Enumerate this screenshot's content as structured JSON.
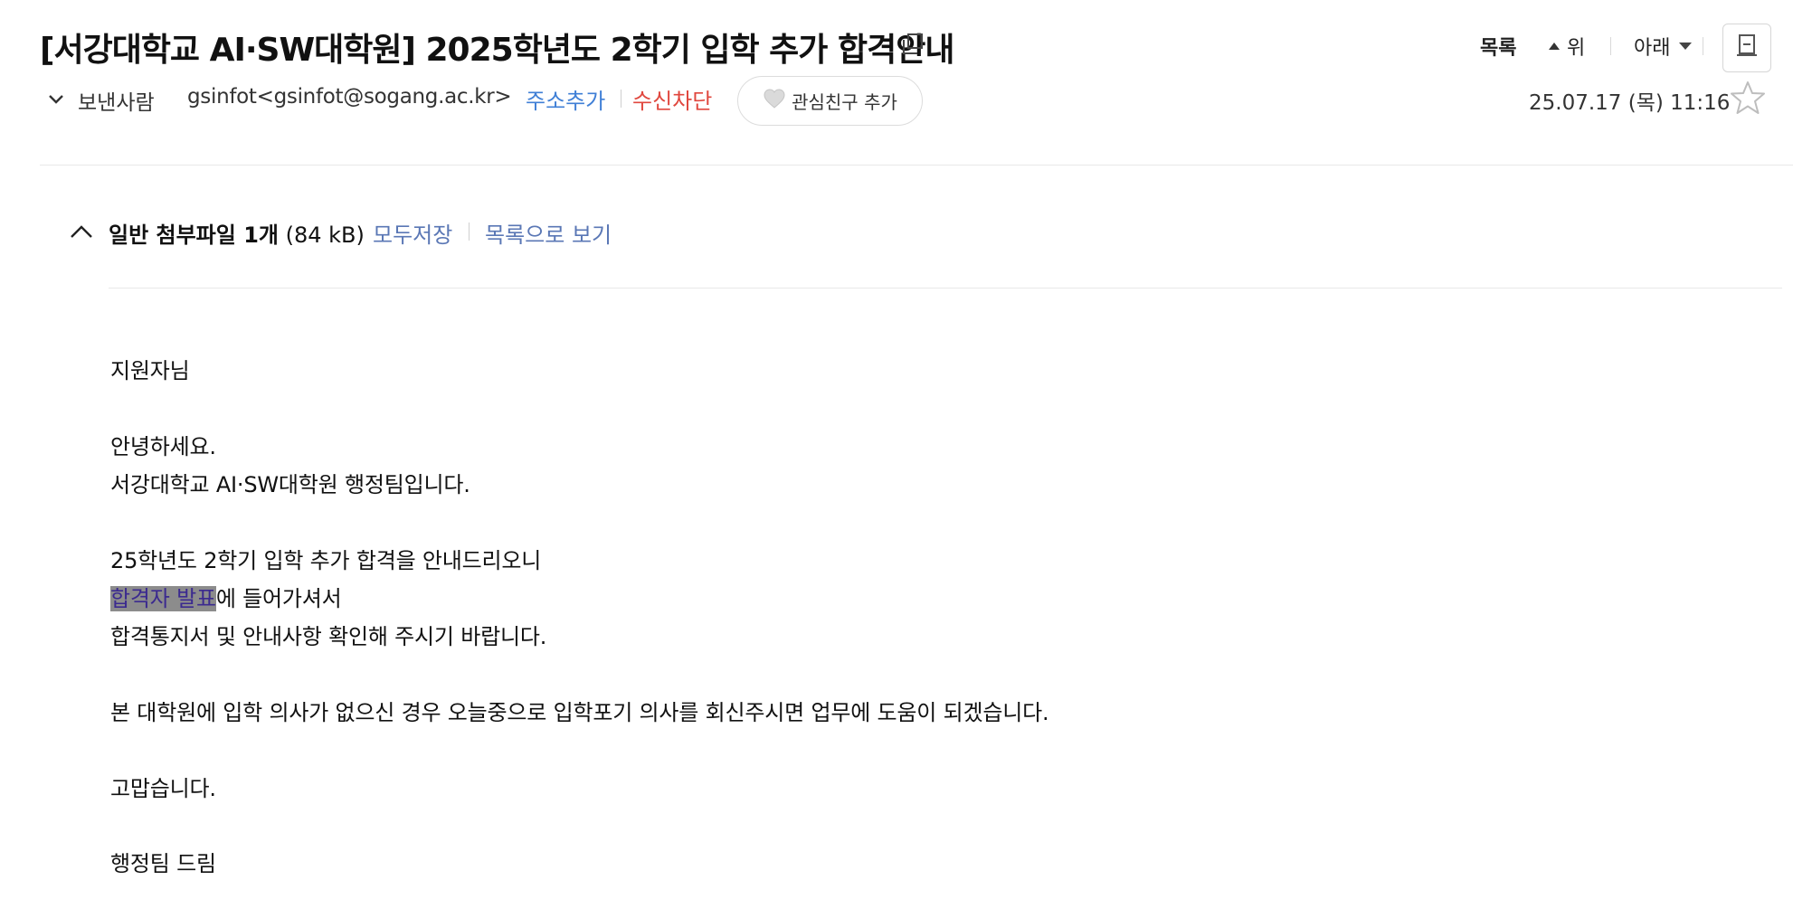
{
  "header": {
    "title": "[서강대학교 AI·SW대학원] 2025학년도 2학기 입학 추가 합격안내",
    "nav_list": "목록",
    "nav_up": "위",
    "nav_down": "아래"
  },
  "sender": {
    "label": "보낸사람",
    "address": "gsinfot<gsinfot@sogang.ac.kr>",
    "add_address": "주소추가",
    "block": "수신차단",
    "add_friend": "관심친구 추가",
    "date": "25.07.17 (목) 11:16"
  },
  "attachments": {
    "title_bold": "일반 첨부파일 1개",
    "size": "(84 kB)",
    "save_all": "모두저장",
    "view_list": "목록으로 보기"
  },
  "body": {
    "greeting": "지원자님",
    "hello": "안녕하세요.",
    "intro": "서강대학교 AI·SW대학원 행정팀입니다.",
    "notice": "25학년도 2학기 입학 추가 합격을 안내드리오니",
    "link_text": "합격자 발표",
    "link_suffix": "에 들어가셔서",
    "check": "합격통지서 및 안내사항 확인해 주시기 바랍니다.",
    "decline": "본 대학원에 입학 의사가 없으신 경우 오늘중으로 입학포기 의사를  회신주시면 업무에 도움이 되겠습니다.",
    "thanks": "고맙습니다.",
    "signoff": "행정팀 드림"
  },
  "colors": {
    "link_blue": "#3f7fd6",
    "block_red": "#e0473e",
    "attachment_link": "#5a77b5",
    "highlight_bg": "#8c8c8c",
    "highlight_text": "#3b2a8f"
  },
  "icons": [
    "copy-icon",
    "caret-up-icon",
    "caret-down-icon",
    "print-icon",
    "chevron-down-icon",
    "heart-icon",
    "star-icon",
    "chevron-up-icon"
  ]
}
